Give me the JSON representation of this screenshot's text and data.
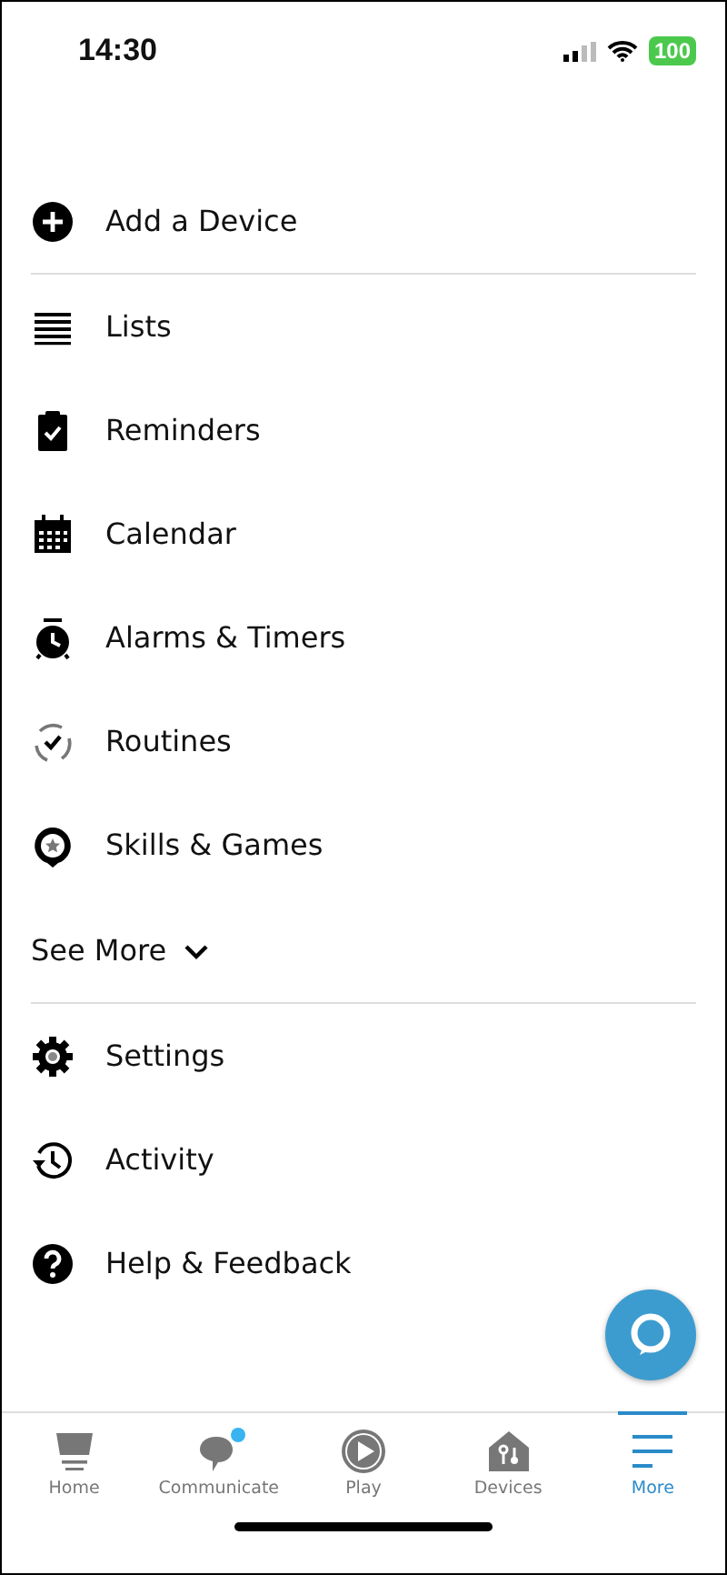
{
  "status_bar": {
    "time": "14:30",
    "battery": "100"
  },
  "add_device": {
    "label": "Add a Device"
  },
  "menu": [
    {
      "kind": "lists",
      "label": "Lists"
    },
    {
      "kind": "reminders",
      "label": "Reminders"
    },
    {
      "kind": "calendar",
      "label": "Calendar"
    },
    {
      "kind": "alarms",
      "label": "Alarms & Timers"
    },
    {
      "kind": "routines",
      "label": "Routines"
    },
    {
      "kind": "skills",
      "label": "Skills & Games"
    }
  ],
  "see_more": {
    "label": "See More",
    "expanded": false
  },
  "secondary_menu": [
    {
      "kind": "settings",
      "label": "Settings"
    },
    {
      "kind": "activity",
      "label": "Activity"
    },
    {
      "kind": "help",
      "label": "Help & Feedback"
    }
  ],
  "tabs": [
    {
      "kind": "home",
      "label": "Home",
      "selected": false,
      "notification": false
    },
    {
      "kind": "communicate",
      "label": "Communicate",
      "selected": false,
      "notification": true
    },
    {
      "kind": "play",
      "label": "Play",
      "selected": false,
      "notification": false
    },
    {
      "kind": "devices",
      "label": "Devices",
      "selected": false,
      "notification": false
    },
    {
      "kind": "more",
      "label": "More",
      "selected": true,
      "notification": false
    }
  ]
}
